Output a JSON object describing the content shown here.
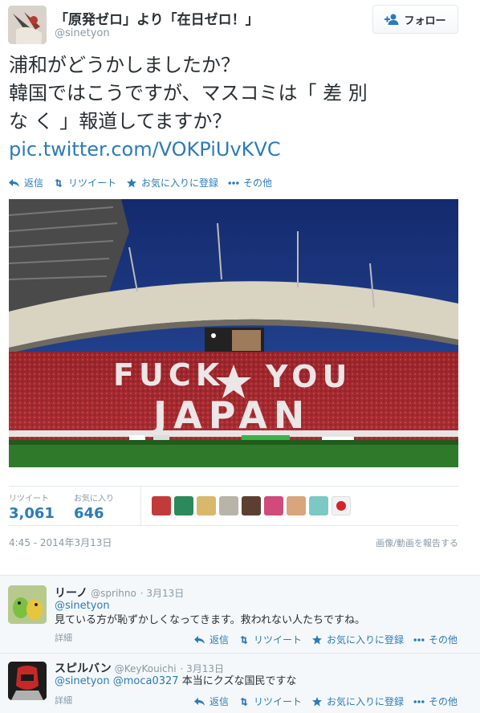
{
  "tweet": {
    "display_name": "「原発ゼロ」より「在日ゼロ！」",
    "handle": "@sinetyon",
    "follow_label": "フォロー",
    "text_lines": [
      "浦和がどうかしましたか？",
      "韓国ではこうですが、マスコミは「 差 別",
      "な く 」報道してますか？"
    ],
    "link": "pic.twitter.com/VOKPiUvKVC",
    "actions": {
      "reply": "返信",
      "retweet": "リツイート",
      "favorite": "お気に入りに登録",
      "more": "その他"
    },
    "stats": {
      "retweets_label": "リツイート",
      "retweets": "3,061",
      "favorites_label": "お気に入り",
      "favorites": "646"
    },
    "timestamp": "4:45 - 2014年3月13日",
    "report_label": "画像/動画を報告する"
  },
  "replies": [
    {
      "name": "リーノ",
      "handle": "@sprihno",
      "date": "· 3月13日",
      "mention": "@sinetyon",
      "body": "見ている方が恥ずかしくなってきます。救われない人たちですね。",
      "detail": "詳細"
    },
    {
      "name": "スピルバン",
      "handle": "@KeyKouichi",
      "date": "· 3月13日",
      "mention": "@sinetyon @moca0327",
      "body": "本当にクズな国民ですな",
      "detail": "詳細"
    }
  ],
  "colors": {
    "link": "#2b7bb9",
    "muted": "#8899a6",
    "text": "#292f33",
    "border": "#e1e8ed"
  },
  "icons": [
    "follow-icon",
    "reply-icon",
    "retweet-icon",
    "favorite-icon",
    "more-icon"
  ]
}
